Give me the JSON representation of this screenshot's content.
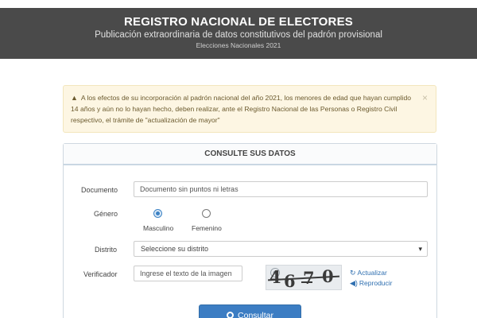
{
  "header": {
    "title": "REGISTRO NACIONAL DE ELECTORES",
    "subtitle": "Publicación extraordinaria de datos constitutivos del padrón provisional",
    "edition": "Elecciones Nacionales 2021"
  },
  "alert": {
    "text": "A los efectos de su incorporación al padrón nacional del año 2021, los menores de edad que hayan cumplido 14 años y aún no lo hayan hecho, deben realizar, ante el Registro Nacional de las Personas o Registro Civil respectivo, el trámite de \"actualización de mayor\"",
    "close_label": "×"
  },
  "panel": {
    "title": "CONSULTE SUS DATOS"
  },
  "form": {
    "documento": {
      "label": "Documento",
      "placeholder": "Documento sin puntos ni letras"
    },
    "genero": {
      "label": "Género",
      "options": [
        {
          "label": "Masculino",
          "checked": true
        },
        {
          "label": "Femenino",
          "checked": false
        }
      ]
    },
    "distrito": {
      "label": "Distrito",
      "selected": "Seleccione su distrito"
    },
    "verificador": {
      "label": "Verificador",
      "placeholder": "Ingrese el texto de la imagen",
      "captcha_text": "4670",
      "refresh_label": "Actualizar",
      "play_label": "Reproducir"
    },
    "submit_label": "Consultar"
  },
  "icons": {
    "warning": "warning-icon",
    "close": "close-icon",
    "dropdown": "chevron-down-icon",
    "refresh": "refresh-icon",
    "audio": "audio-icon",
    "search": "search-icon"
  },
  "colors": {
    "header_bg": "#4a4a4a",
    "alert_bg": "#fdf6e3",
    "primary": "#3c7dc3",
    "link": "#2f6fb0"
  }
}
